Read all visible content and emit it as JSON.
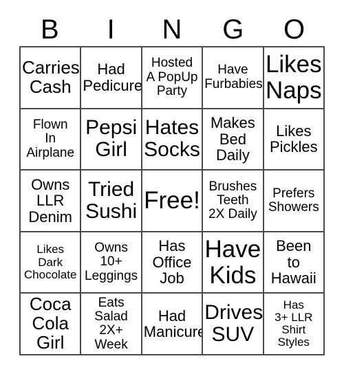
{
  "card": {
    "title": "BINGO",
    "header_letters": [
      "B",
      "I",
      "N",
      "G",
      "O"
    ],
    "grid_size": "5x5",
    "free_space_label": "Free!",
    "colors": {
      "background": "#ffffff",
      "text": "#000000",
      "grid_line": "#4a4a4a"
    },
    "rows": [
      [
        {
          "text": "Carries\nCash",
          "size": "lg"
        },
        {
          "text": "Had\nPedicure",
          "size": "md"
        },
        {
          "text": "Hosted\nA PopUp\nParty",
          "size": "sm"
        },
        {
          "text": "Have\nFurbabies",
          "size": "sm"
        },
        {
          "text": "Likes\nNaps",
          "size": "xxl"
        }
      ],
      [
        {
          "text": "Flown\nIn\nAirplane",
          "size": "sm"
        },
        {
          "text": "Pepsi\nGirl",
          "size": "xl"
        },
        {
          "text": "Hates\nSocks",
          "size": "xl"
        },
        {
          "text": "Makes\nBed\nDaily",
          "size": "md"
        },
        {
          "text": "Likes\nPickles",
          "size": "md"
        }
      ],
      [
        {
          "text": "Owns\nLLR\nDenim",
          "size": "md"
        },
        {
          "text": "Tried\nSushi",
          "size": "xl"
        },
        {
          "text": "Free!",
          "size": "xxl"
        },
        {
          "text": "Brushes\nTeeth\n2X Daily",
          "size": "sm"
        },
        {
          "text": "Prefers\nShowers",
          "size": "sm"
        }
      ],
      [
        {
          "text": "Likes\nDark\nChocolate",
          "size": "xs"
        },
        {
          "text": "Owns\n10+\nLeggings",
          "size": "sm"
        },
        {
          "text": "Has\nOffice\nJob",
          "size": "md"
        },
        {
          "text": "Have\nKids",
          "size": "xxl"
        },
        {
          "text": "Been\nto\nHawaii",
          "size": "md"
        }
      ],
      [
        {
          "text": "Coca\nCola\nGirl",
          "size": "lg"
        },
        {
          "text": "Eats\nSalad\n2X+ Week",
          "size": "sm"
        },
        {
          "text": "Had\nManicure",
          "size": "md"
        },
        {
          "text": "Drives\nSUV",
          "size": "xl"
        },
        {
          "text": "Has\n3+ LLR\nShirt\nStyles",
          "size": "xs"
        }
      ]
    ]
  }
}
